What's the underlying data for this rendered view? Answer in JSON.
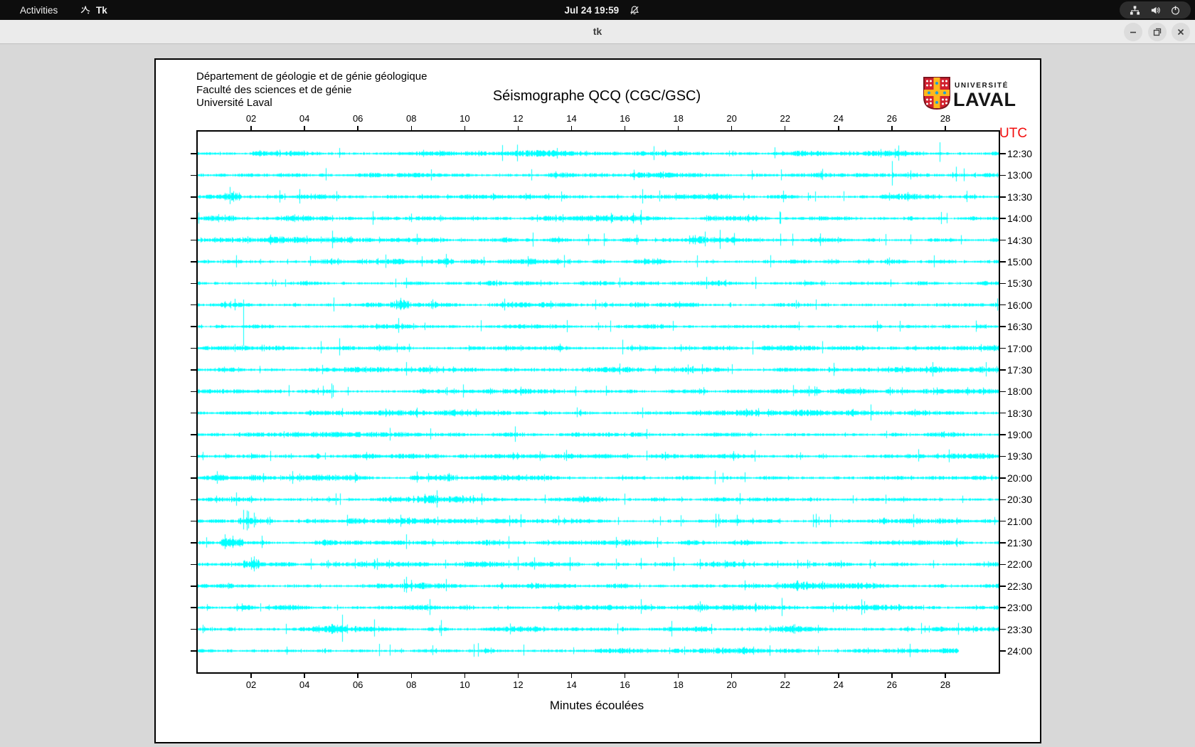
{
  "topbar": {
    "activities_label": "Activities",
    "app_name": "Tk",
    "clock": "Jul 24 19:59",
    "icons": [
      "tk-icon",
      "notifications-off-icon",
      "network-wired-icon",
      "volume-icon",
      "power-icon"
    ]
  },
  "titlebar": {
    "title": "tk",
    "buttons": [
      "minimize",
      "maximize",
      "close"
    ]
  },
  "paper": {
    "header_lines": [
      "Département de géologie et de génie géologique",
      "Faculté des sciences et de génie",
      "Université Laval"
    ],
    "title": "Séismographe QCQ (CGC/GSC)",
    "logo": {
      "line1": "UNIVERSITÉ",
      "line2": "LAVAL",
      "shield_red": "#d1202f",
      "shield_gold": "#ffb81c",
      "shield_blue": "#1e9cd7"
    },
    "utc_label": "UTC",
    "utc_color": "#f20d0d",
    "x_axis_label": "Minutes écoulées"
  },
  "chart_data": {
    "type": "line",
    "subtype": "seismogram-helicorder",
    "station": "QCQ (CGC/GSC)",
    "x_unit": "minutes",
    "x_range": [
      0,
      30
    ],
    "x_ticks": [
      "02",
      "04",
      "06",
      "08",
      "10",
      "12",
      "14",
      "16",
      "18",
      "20",
      "22",
      "24",
      "26",
      "28"
    ],
    "row_labels": [
      "12:30",
      "13:00",
      "13:30",
      "14:00",
      "14:30",
      "15:00",
      "15:30",
      "16:00",
      "16:30",
      "17:00",
      "17:30",
      "18:00",
      "18:30",
      "19:00",
      "19:30",
      "20:00",
      "20:30",
      "21:00",
      "21:30",
      "22:00",
      "22:30",
      "23:00",
      "23:30",
      "24:00"
    ],
    "trace_color": "#00ffff",
    "last_row_end_minute": 28.5,
    "events": [
      [
        0,
        5.3,
        8
      ],
      [
        0,
        21.6,
        9
      ],
      [
        0,
        27.8,
        16
      ],
      [
        1,
        4.8,
        10
      ],
      [
        1,
        23.4,
        9
      ],
      [
        1,
        26.0,
        20
      ],
      [
        1,
        28.4,
        12
      ],
      [
        2,
        1.2,
        14
      ],
      [
        2,
        5.2,
        8
      ],
      [
        2,
        17.3,
        9
      ],
      [
        2,
        24.2,
        8
      ],
      [
        3,
        8.0,
        7
      ],
      [
        3,
        16.6,
        12
      ],
      [
        3,
        21.8,
        10
      ],
      [
        4,
        8.2,
        9
      ],
      [
        4,
        19.0,
        12
      ],
      [
        4,
        20.1,
        10
      ],
      [
        4,
        26.7,
        8
      ],
      [
        5,
        4.2,
        8
      ],
      [
        5,
        9.3,
        11
      ],
      [
        5,
        10.7,
        7
      ],
      [
        6,
        2.8,
        6
      ],
      [
        6,
        15.8,
        8
      ],
      [
        7,
        7.6,
        10
      ],
      [
        7,
        8.8,
        8
      ],
      [
        7,
        22.4,
        7
      ],
      [
        8,
        1.7,
        38
      ],
      [
        8,
        7.5,
        12
      ],
      [
        8,
        10.6,
        9
      ],
      [
        8,
        17.8,
        8
      ],
      [
        8,
        22.5,
        7
      ],
      [
        9,
        4.6,
        10
      ],
      [
        9,
        5.3,
        14
      ],
      [
        9,
        15.9,
        12
      ],
      [
        9,
        23.4,
        10
      ],
      [
        10,
        7.8,
        11
      ],
      [
        10,
        15.8,
        9
      ],
      [
        10,
        18.9,
        8
      ],
      [
        10,
        20.0,
        8
      ],
      [
        11,
        3.4,
        9
      ],
      [
        11,
        4.7,
        8
      ],
      [
        11,
        15.3,
        8
      ],
      [
        11,
        22.3,
        9
      ],
      [
        12,
        5.4,
        7
      ],
      [
        12,
        14.2,
        8
      ],
      [
        12,
        21.0,
        7
      ],
      [
        13,
        8.7,
        9
      ],
      [
        13,
        16.8,
        8
      ],
      [
        14,
        13.8,
        9
      ],
      [
        14,
        16.8,
        8
      ],
      [
        14,
        27.0,
        10
      ],
      [
        15,
        8.2,
        9
      ],
      [
        15,
        9.4,
        7
      ],
      [
        15,
        20.5,
        8
      ],
      [
        16,
        8.5,
        8
      ],
      [
        16,
        13.0,
        7
      ],
      [
        16,
        20.3,
        9
      ],
      [
        17,
        1.7,
        16
      ],
      [
        17,
        1.9,
        14
      ],
      [
        17,
        2.1,
        12
      ],
      [
        17,
        5.6,
        9
      ],
      [
        17,
        13.5,
        8
      ],
      [
        17,
        19.5,
        10
      ],
      [
        17,
        20.2,
        9
      ],
      [
        18,
        1.0,
        12
      ],
      [
        18,
        1.3,
        10
      ],
      [
        18,
        2.4,
        10
      ],
      [
        18,
        7.8,
        12
      ],
      [
        19,
        2.0,
        10
      ],
      [
        19,
        5.9,
        8
      ],
      [
        19,
        12.0,
        11
      ],
      [
        19,
        12.6,
        10
      ],
      [
        19,
        16.6,
        9
      ],
      [
        20,
        7.8,
        13
      ],
      [
        20,
        9.3,
        10
      ],
      [
        20,
        20.5,
        8
      ],
      [
        20,
        23.4,
        7
      ],
      [
        21,
        13.5,
        7
      ],
      [
        21,
        16.6,
        12
      ],
      [
        21,
        18.8,
        9
      ],
      [
        22,
        6.6,
        14
      ],
      [
        22,
        9.1,
        13
      ],
      [
        22,
        27.1,
        9
      ],
      [
        23,
        6.8,
        10
      ],
      [
        23,
        7.2,
        9
      ],
      [
        23,
        8.8,
        8
      ],
      [
        23,
        10.5,
        11
      ],
      [
        23,
        12.2,
        9
      ]
    ],
    "bursts": [
      [
        2,
        0.8,
        1.6,
        2.2
      ],
      [
        4,
        18.4,
        20.2,
        2.3
      ],
      [
        5,
        9.0,
        9.6,
        1.8
      ],
      [
        7,
        7.2,
        7.9,
        2.0
      ],
      [
        12,
        14.0,
        14.5,
        1.6
      ],
      [
        15,
        8.0,
        9.6,
        1.9
      ],
      [
        16,
        8.2,
        9.0,
        1.9
      ],
      [
        17,
        1.5,
        2.4,
        2.4
      ],
      [
        18,
        0.8,
        1.7,
        2.2
      ],
      [
        19,
        1.7,
        2.3,
        2.0
      ],
      [
        22,
        5.0,
        5.6,
        1.7
      ]
    ]
  }
}
